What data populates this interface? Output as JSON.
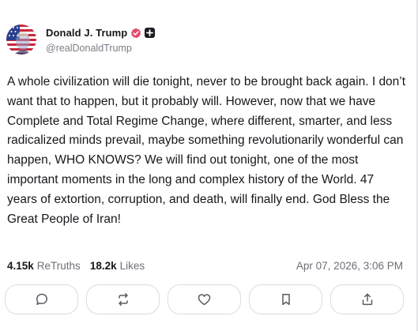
{
  "author": {
    "display_name": "Donald J. Trump",
    "handle": "@realDonaldTrump",
    "avatar_icon": "flag-portrait-avatar",
    "verified_icon": "verified-check-icon",
    "badge_icon": "plus-badge-icon"
  },
  "post": {
    "text": "A whole civilization will die tonight, never to be brought back again. I don’t want that to happen, but it probably will. However, now that we have Complete and Total Regime Change, where different, smarter, and less radicalized minds prevail, maybe something revolutionarily wonderful can happen, WHO KNOWS? We will find out tonight, one of the most important moments in the long and complex history of the World. 47 years of extortion, corruption, and death, will finally end. God Bless the Great People of Iran!",
    "retruths_count": "4.15k",
    "retruths_label": "ReTruths",
    "likes_count": "18.2k",
    "likes_label": "Likes",
    "timestamp": "Apr 07, 2026, 3:06 PM"
  },
  "actions": [
    {
      "name": "reply",
      "icon": "comment-icon"
    },
    {
      "name": "retruth",
      "icon": "repost-icon"
    },
    {
      "name": "like",
      "icon": "heart-icon"
    },
    {
      "name": "bookmark",
      "icon": "bookmark-icon"
    },
    {
      "name": "share",
      "icon": "share-icon"
    }
  ],
  "colors": {
    "verified": "#e24c6f",
    "text": "#17171c",
    "muted": "#6e6e78",
    "border": "#dcdce2"
  }
}
